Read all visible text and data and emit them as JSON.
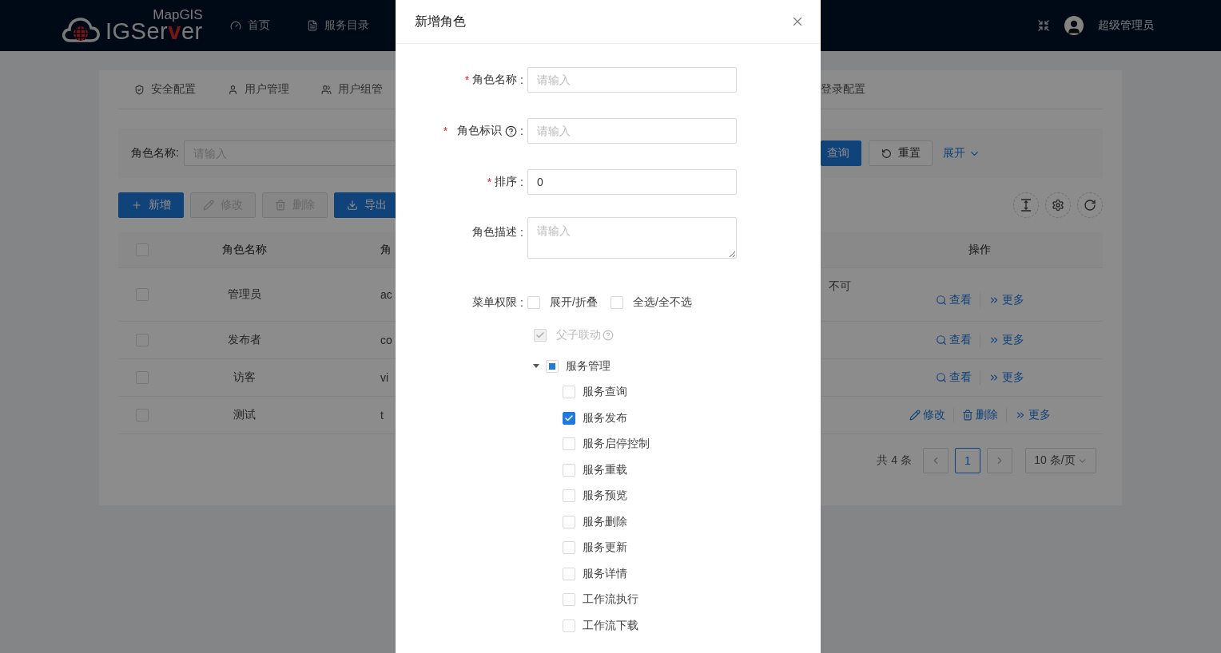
{
  "header": {
    "logo": {
      "top": "MapGIS",
      "parts": [
        {
          "text": "IGSer",
          "accent": false
        },
        {
          "text": "v",
          "accent": true
        },
        {
          "text": "er",
          "accent": false
        }
      ]
    },
    "nav": [
      {
        "label": "首页"
      },
      {
        "label": "服务目录"
      }
    ],
    "user": "超级管理员"
  },
  "tabs": {
    "left": [
      {
        "label": "安全配置"
      },
      {
        "label": "用户管理"
      },
      {
        "label": "用户组管"
      }
    ],
    "right": [
      {
        "label": "登录配置"
      }
    ]
  },
  "search": {
    "label": "角色名称:",
    "placeholder": "请输入",
    "buttons": [
      {
        "label": "查询",
        "kind": "primary"
      },
      {
        "label": "重置",
        "kind": "default"
      }
    ],
    "expand": "展开"
  },
  "toolbar": [
    {
      "label": "新增",
      "kind": "primary"
    },
    {
      "label": "修改",
      "kind": "disabled"
    },
    {
      "label": "删除",
      "kind": "disabled"
    },
    {
      "label": "导出",
      "kind": "primary"
    }
  ],
  "table": {
    "all_checked": false,
    "columns": [
      "角色名称",
      "角"
    ],
    "action_column": "操作",
    "rows": [
      {
        "checked": false,
        "name": "管理员",
        "code": "ac",
        "column_3": "不可",
        "actions": [
          {
            "label": "查看",
            "kind": "view"
          },
          {
            "label": "更多",
            "kind": "more"
          }
        ]
      },
      {
        "checked": false,
        "name": "发布者",
        "code": "co",
        "actions": [
          {
            "label": "查看",
            "kind": "view"
          },
          {
            "label": "更多",
            "kind": "more"
          }
        ]
      },
      {
        "checked": false,
        "name": "访客",
        "code": "vi",
        "actions": [
          {
            "label": "查看",
            "kind": "view"
          },
          {
            "label": "更多",
            "kind": "more"
          }
        ]
      },
      {
        "checked": false,
        "name": "测试",
        "code": "t",
        "actions": [
          {
            "label": "修改",
            "kind": "edit"
          },
          {
            "label": "删除",
            "kind": "delete"
          },
          {
            "label": "更多",
            "kind": "more"
          }
        ]
      }
    ]
  },
  "pagination": {
    "total": "共 4 条",
    "pages": [
      {
        "label": "1",
        "selected": true
      }
    ],
    "page_size": "10 条/页"
  },
  "modal": {
    "title": "新增角色",
    "fields": [
      {
        "required_mark": "*",
        "label": "角色名称",
        "help": false,
        "suffix": ":",
        "kind": "input",
        "placeholder": "请输入"
      },
      {
        "required_mark": "*",
        "label": "角色标识",
        "help": true,
        "suffix": ":",
        "kind": "input",
        "placeholder": "请输入"
      },
      {
        "required_mark": "*",
        "label": "排序",
        "help": false,
        "suffix": ":",
        "kind": "input",
        "value": "0"
      },
      {
        "label": "角色描述",
        "help": false,
        "suffix": ":",
        "kind": "textarea",
        "placeholder": "请输入"
      }
    ],
    "menu": {
      "label": "菜单权限",
      "suffix": ":",
      "options": [
        {
          "label": "展开/折叠",
          "checked": false
        },
        {
          "label": "全选/全不选",
          "checked": false
        }
      ],
      "linkage": {
        "label": "父子联动",
        "checked": true,
        "disabled": true
      },
      "tree": [
        {
          "label": "服务管理",
          "expanded": true,
          "checked": false,
          "indeterminate": true,
          "children": [
            {
              "label": "服务查询",
              "checked": false
            },
            {
              "label": "服务发布",
              "checked": true
            },
            {
              "label": "服务启停控制",
              "checked": false
            },
            {
              "label": "服务重载",
              "checked": false
            },
            {
              "label": "服务预览",
              "checked": false
            },
            {
              "label": "服务删除",
              "checked": false
            },
            {
              "label": "服务更新",
              "checked": false
            },
            {
              "label": "服务详情",
              "checked": false
            },
            {
              "label": "工作流执行",
              "checked": false
            },
            {
              "label": "工作流下载",
              "checked": false
            }
          ]
        }
      ]
    }
  }
}
